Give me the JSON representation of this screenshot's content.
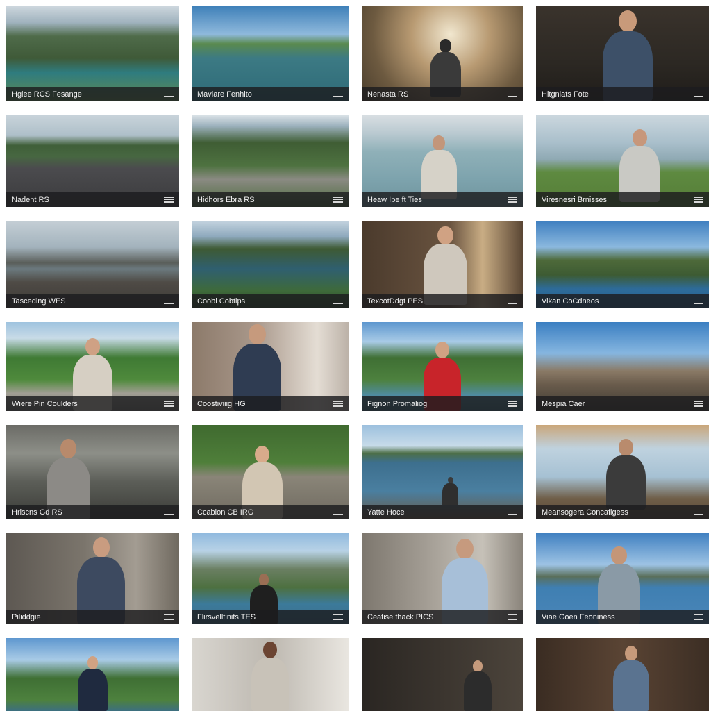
{
  "tiles": [
    {
      "caption": "Hgiee RCS Fesange",
      "scene": "landscape-lake",
      "person": false
    },
    {
      "caption": "Maviare Fenhito",
      "scene": "sea-island",
      "person": false
    },
    {
      "caption": "Nenasta RS",
      "scene": "forest-walker",
      "person": true
    },
    {
      "caption": "Hitgniats Fote",
      "scene": "office-headphones",
      "person": true
    },
    {
      "caption": "Nadent RS",
      "scene": "road-vehicles",
      "person": false
    },
    {
      "caption": "Hidhors Ebra RS",
      "scene": "valley-river",
      "person": false
    },
    {
      "caption": "Heaw Ipe ft Ties",
      "scene": "sea-rocks-woman",
      "person": true
    },
    {
      "caption": "Viresnesri Brnisses",
      "scene": "lake-meadow-woman",
      "person": true
    },
    {
      "caption": "Tasceding WES",
      "scene": "rocky-shore",
      "person": false
    },
    {
      "caption": "Coobl Cobtips",
      "scene": "fjord-valley",
      "person": false
    },
    {
      "caption": "TexcotDdgt PES",
      "scene": "room-woman",
      "person": true
    },
    {
      "caption": "Vikan CoCdneos",
      "scene": "mountain-lake",
      "person": false
    },
    {
      "caption": "Wiere Pin Coulders",
      "scene": "path-woman",
      "person": true
    },
    {
      "caption": "Coostiviiig HG",
      "scene": "studio-man-glasses",
      "person": true
    },
    {
      "caption": "Fignon Promaliog",
      "scene": "valley-woman",
      "person": true
    },
    {
      "caption": "Mespia Caer",
      "scene": "mountain-sky",
      "person": false
    },
    {
      "caption": "Hriscns Gd RS",
      "scene": "glasshouse-man",
      "person": true
    },
    {
      "caption": "Ccablon CB IRG",
      "scene": "road-woman",
      "person": true
    },
    {
      "caption": "Yatte Hoce",
      "scene": "pier-lake",
      "person": true
    },
    {
      "caption": "Meansogera Concafigess",
      "scene": "deck-man",
      "person": true
    },
    {
      "caption": "Piliddgie",
      "scene": "room-man-blazer",
      "person": true
    },
    {
      "caption": "Flirsvelltinits TES",
      "scene": "harbor-woman",
      "person": true
    },
    {
      "caption": "Ceatise thack PICS",
      "scene": "room-man-shirt",
      "person": true
    },
    {
      "caption": "Viae Goen Feoniness",
      "scene": "lakeside-man",
      "person": true
    },
    {
      "caption": "",
      "scene": "valley-woman-2",
      "person": true
    },
    {
      "caption": "",
      "scene": "studio-interview",
      "person": true
    },
    {
      "caption": "",
      "scene": "camera-operator",
      "person": true
    },
    {
      "caption": "",
      "scene": "library-man",
      "person": true
    }
  ]
}
